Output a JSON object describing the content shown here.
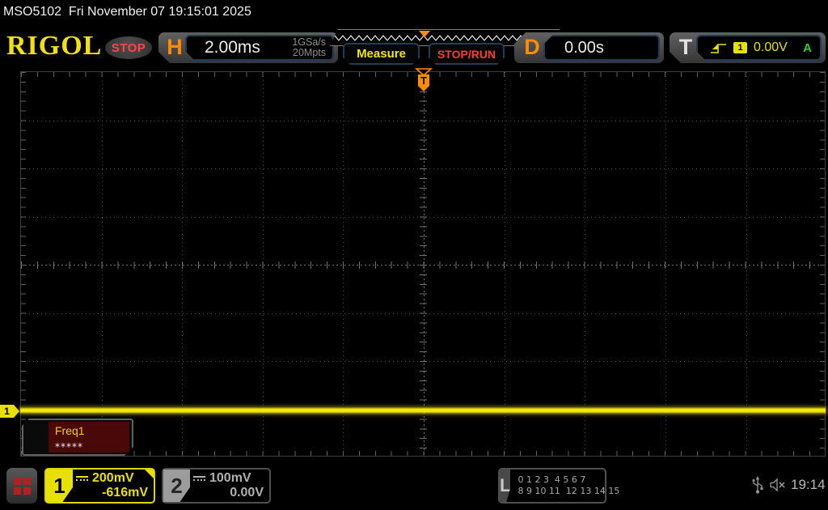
{
  "colors": {
    "accent_yellow": "#e8e000",
    "accent_orange": "#ff8c00",
    "stop_red": "#ff4545",
    "run_green": "#33cc33",
    "ch2_gray": "#9c9c9c"
  },
  "top_bar": {
    "title": "MSO5102  Fri November 07 19:15:01 2025"
  },
  "header": {
    "logo": "RIGOL",
    "acq_status": "STOP",
    "horizontal": {
      "label": "H",
      "timebase": "2.00ms",
      "sample_rate": "1GSa/s",
      "memory_depth": "20Mpts"
    },
    "measure_button": "Measure",
    "stoprun_button": "STOP/RUN",
    "delay": {
      "label": "D",
      "value": "0.00s"
    },
    "trigger": {
      "label": "T",
      "type_icon": "rising-edge-trigger-icon",
      "source_badge": "1",
      "level": "0.00V",
      "sweep": "A"
    }
  },
  "graticule": {
    "trigger_position_marker": "T",
    "ch1_ground_marker": "1"
  },
  "measurement_box": {
    "name": "Freq1",
    "value": "*****"
  },
  "bottom_bar": {
    "ch1": {
      "number": "1",
      "scale": "200mV",
      "offset": "-616mV",
      "coupling_icon": "dc-coupling"
    },
    "ch2": {
      "number": "2",
      "scale": "100mV",
      "offset": "0.00V",
      "coupling_icon": "dc-coupling"
    },
    "logic": {
      "label": "L",
      "row1": "0 1 2 3  4 5 6 7",
      "row2": "8 9 10 11  12 13 14 15"
    },
    "status": {
      "usb_icon": "usb",
      "sound_icon": "muted-speaker",
      "clock": "19:14"
    }
  }
}
